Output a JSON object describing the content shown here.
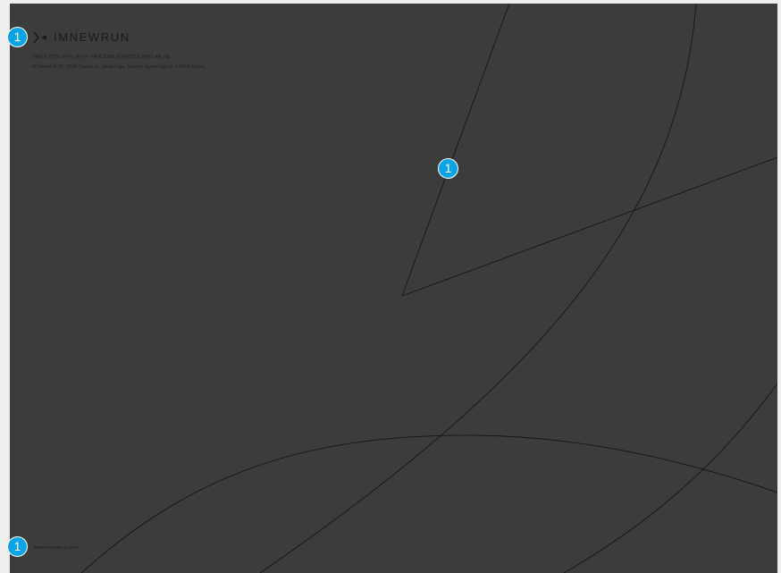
{
  "brand": {
    "name": "IMNEWRUN",
    "logo_icon": "arrowhead-bracket-icon"
  },
  "address": {
    "korean": "14419 경기도 수원시 장안구 서부로 2066 성균관대학교 N센터 A동 5층",
    "english": "N Center A-5F, 2066 Seobu-ro, Jangan-gu, Suwon, Gyeonggi-do 14419, Korea"
  },
  "website": "www.imnewrun.com",
  "markers": {
    "top_left": "1",
    "center": "1",
    "bottom_left": "1"
  },
  "colors": {
    "sheet_background": "#3d3c3c",
    "line": "#151515",
    "marker": "#0aa3e6",
    "page_background": "#eeeeee"
  }
}
